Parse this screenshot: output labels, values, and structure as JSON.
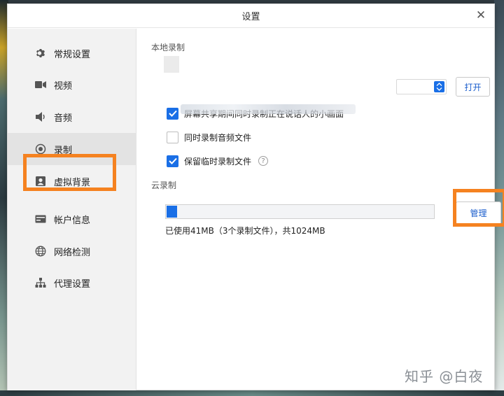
{
  "window": {
    "title": "设置"
  },
  "sidebar": {
    "items": [
      {
        "label": "常规设置",
        "icon": "gear-icon"
      },
      {
        "label": "视频",
        "icon": "video-camera-icon"
      },
      {
        "label": "音频",
        "icon": "speaker-icon"
      },
      {
        "label": "录制",
        "icon": "record-icon",
        "active": true
      },
      {
        "label": "虚拟背景",
        "icon": "portrait-icon"
      },
      {
        "label": "帐户信息",
        "icon": "id-card-icon"
      },
      {
        "label": "网络检测",
        "icon": "globe-icon"
      },
      {
        "label": "代理设置",
        "icon": "network-tree-icon"
      }
    ]
  },
  "local_recording": {
    "section_title": "本地录制",
    "open_button": "打开",
    "options": [
      {
        "label": "屏幕共享期间同时录制正在说话人的小画面",
        "checked": true
      },
      {
        "label": "同时录制音频文件",
        "checked": false
      },
      {
        "label": "保留临时录制文件",
        "checked": true,
        "help": "?"
      }
    ]
  },
  "cloud_recording": {
    "section_title": "云录制",
    "usage_fraction": 0.04,
    "usage_text": "已使用41MB（3个录制文件），共1024MB",
    "manage_button": "管理"
  },
  "watermark": "知乎 @白夜",
  "colors": {
    "accent": "#1a6fe6",
    "highlight": "#f58220"
  }
}
